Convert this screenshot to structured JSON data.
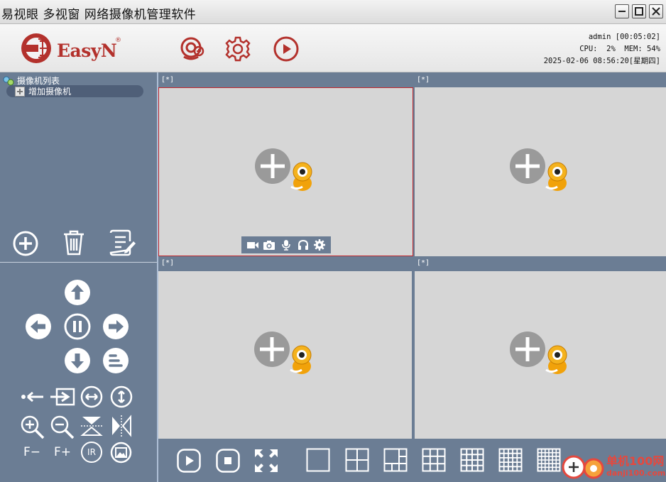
{
  "window": {
    "title": "易视眼 多视窗 网络摄像机管理软件"
  },
  "header": {
    "logo_text": "EasyN",
    "logo_reg": "®",
    "status_user": "admin [00:05:02]",
    "status_cpu": "CPU:  2%  MEM: 54%",
    "status_datetime": "2025-02-06 08:56:20[星期四]"
  },
  "sidebar": {
    "tree_root": "摄像机列表",
    "tree_item": "增加摄像机",
    "ptz": {
      "focus_minus": "F−",
      "focus_plus": "F+",
      "ir": "IR"
    }
  },
  "panes": [
    {
      "label": "[*]"
    },
    {
      "label": "[*]"
    },
    {
      "label": "[*]"
    },
    {
      "label": "[*]"
    }
  ],
  "watermark": {
    "line1": "单机100网",
    "line2": "danji100.com"
  },
  "colors": {
    "accent": "#c0262c",
    "panel": "#6b7d94",
    "pane_bg": "#d6d6d6"
  }
}
